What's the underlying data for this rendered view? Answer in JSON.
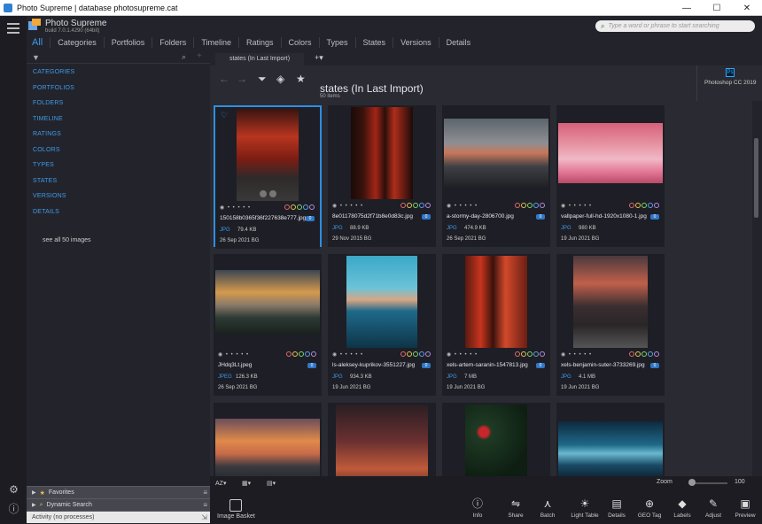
{
  "window": {
    "title": "Photo Supreme | database photosupreme.cat",
    "minimize": "—",
    "maximize": "☐",
    "close": "✕"
  },
  "app": {
    "name": "Photo Supreme",
    "build": "build 7.0.1.4290 (64bit)"
  },
  "search": {
    "placeholder": "Type a word or phrase to start searching"
  },
  "nav_tabs": [
    "All",
    "Categories",
    "Portfolios",
    "Folders",
    "Timeline",
    "Ratings",
    "Colors",
    "Types",
    "States",
    "Versions",
    "Details"
  ],
  "sidebar": {
    "items": [
      "CATEGORIES",
      "PORTFOLIOS",
      "FOLDERS",
      "TIMELINE",
      "RATINGS",
      "COLORS",
      "TYPES",
      "STATES",
      "VERSIONS",
      "DETAILS"
    ],
    "see_all": "see all 50 images",
    "panels": [
      {
        "label": "Favorites"
      },
      {
        "label": "Dynamic Search"
      },
      {
        "label": "Activity (no processes)"
      }
    ]
  },
  "view_tab": "states (In Last Import)",
  "add_tab": "+▾",
  "view": {
    "title": "states (In Last Import)",
    "count": "50 items"
  },
  "external_tool": {
    "icon_text": "Ps",
    "label": "Photoshop CC 2019"
  },
  "cards": [
    {
      "name": "150158b0365f36f227638e777.jpg",
      "type": "JPG",
      "size": "79.4 KB",
      "date": "26 Sep 2021  BG",
      "badge": "0"
    },
    {
      "name": "8e01178075d2f71b8e0d83c.jpg",
      "type": "JPG",
      "size": "88.9 KB",
      "date": "29 Nov 2015  BG",
      "badge": "0"
    },
    {
      "name": "a-stormy-day-2806700.jpg",
      "type": "JPG",
      "size": "474.9 KB",
      "date": "26 Sep 2021  BG",
      "badge": "0"
    },
    {
      "name": "vallpaper-full-hd-1920x1080-1.jpg",
      "type": "JPG",
      "size": "980 KB",
      "date": "19 Jun 2021  BG",
      "badge": "0"
    },
    {
      "name": "JHdq3Lt.jpeg",
      "type": "JPEG",
      "size": "126.3 KB",
      "date": "26 Sep 2021  BG",
      "badge": "0"
    },
    {
      "name": "ls-aleksey-kuprikov-3551227.jpg",
      "type": "JPG",
      "size": "934.3 KB",
      "date": "19 Jun 2021  BG",
      "badge": "0"
    },
    {
      "name": "xels-artem-saranin-1547813.jpg",
      "type": "JPG",
      "size": "7 MB",
      "date": "19 Jun 2021  BG",
      "badge": "0"
    },
    {
      "name": "xels-benjamin-suter-3733269.jpg",
      "type": "JPG",
      "size": "4.1 MB",
      "date": "19 Jun 2021  BG",
      "badge": "0"
    },
    {
      "name": "",
      "type": "",
      "size": "",
      "date": "",
      "badge": ""
    },
    {
      "name": "",
      "type": "",
      "size": "",
      "date": "",
      "badge": ""
    },
    {
      "name": "",
      "type": "",
      "size": "",
      "date": "",
      "badge": ""
    },
    {
      "name": "",
      "type": "",
      "size": "",
      "date": "",
      "badge": ""
    }
  ],
  "rating_text": "◉ • • • • •",
  "statusbar": {
    "sort": "AZ▾",
    "view1": "▦▾",
    "view2": "▤▾",
    "zoom_label": "Zoom",
    "zoom_value": "100",
    "zoom_level": 0.05
  },
  "bottom": {
    "basket_label": "Image Basket",
    "tools": [
      "Info",
      "Share",
      "Batch",
      "Light Table",
      "Details",
      "GEO Tag",
      "Labels",
      "Adjust",
      "Preview"
    ]
  },
  "colors": {
    "accent": "#3e9be8",
    "selection": "#2f8fe0"
  }
}
